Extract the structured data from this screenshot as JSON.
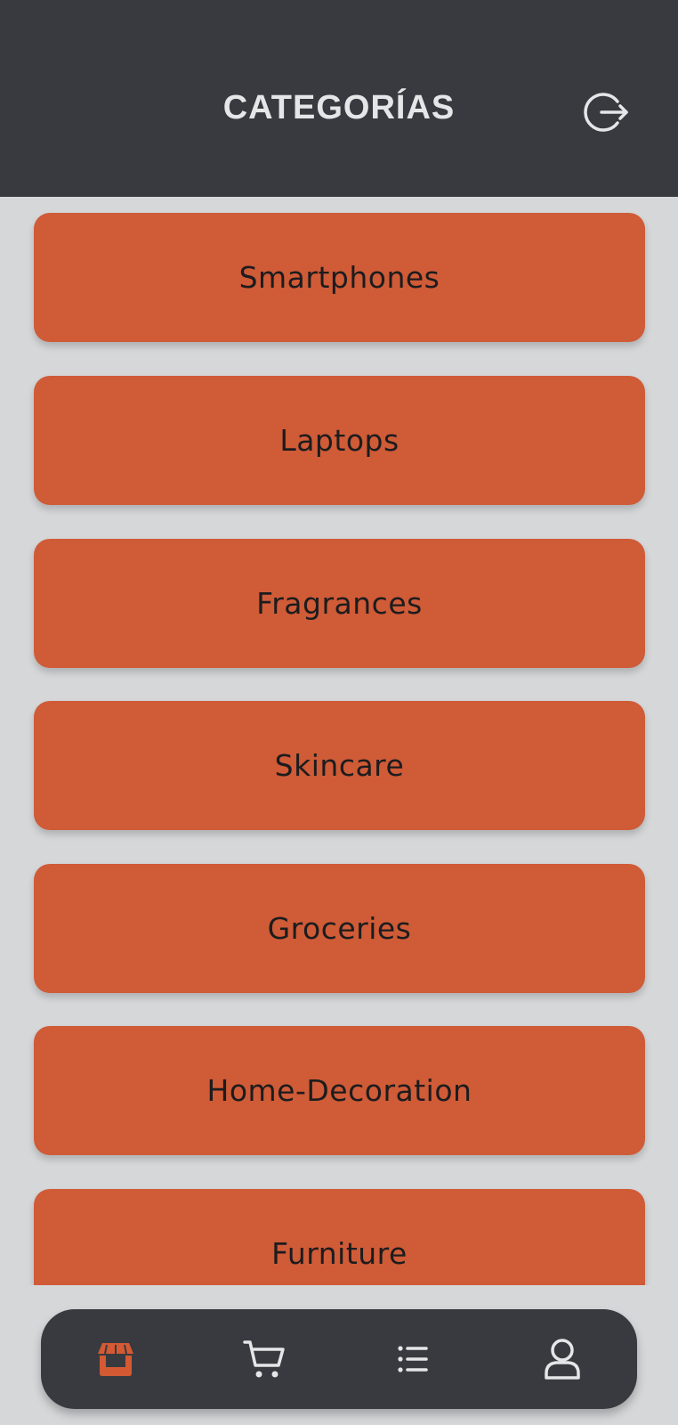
{
  "header": {
    "title": "CATEGORÍAS",
    "logout_icon": "logout-icon"
  },
  "categories": [
    "Smartphones",
    "Laptops",
    "Fragrances",
    "Skincare",
    "Groceries",
    "Home-Decoration",
    "Furniture"
  ],
  "bottom_nav": {
    "items": [
      {
        "icon": "store-icon",
        "active": true
      },
      {
        "icon": "cart-icon",
        "active": false
      },
      {
        "icon": "list-icon",
        "active": false
      },
      {
        "icon": "user-icon",
        "active": false
      }
    ]
  },
  "colors": {
    "header_bg": "#383a40",
    "page_bg": "#d6d7d9",
    "card_bg": "#cf5b37",
    "active_icon": "#d45a33",
    "inactive_icon": "#e6e6e8"
  }
}
